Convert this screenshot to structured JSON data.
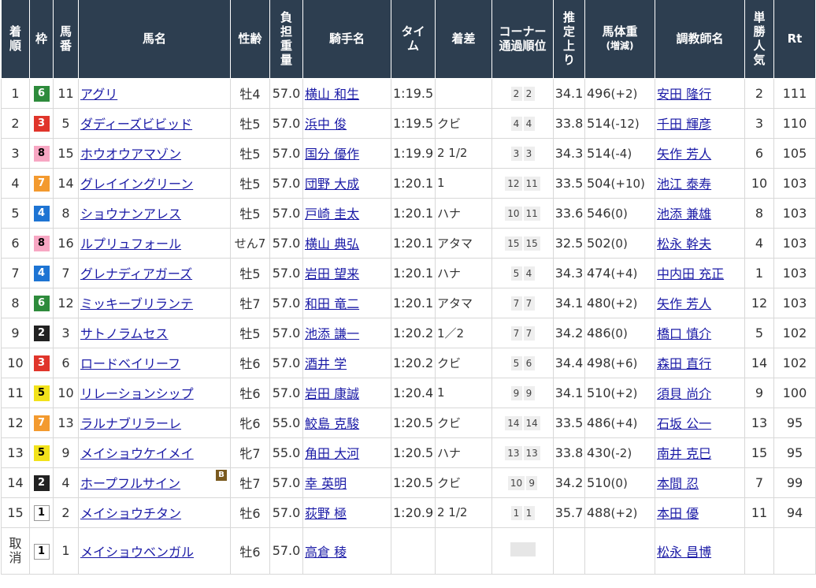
{
  "headers": {
    "finish": "着順",
    "waku": "枠",
    "umaban": "馬番",
    "horse": "馬名",
    "sexage": "性齢",
    "weight": "負担重量",
    "jockey": "騎手名",
    "time": "タイム",
    "margin": "着差",
    "corner": "コーナー通過順位",
    "last3f": "推定上り",
    "bodyweight": "馬体重",
    "bodyweight_sub": "(増減)",
    "trainer": "調教師名",
    "popularity": "単勝人気",
    "rt": "Rt"
  },
  "rows": [
    {
      "finish": "1",
      "waku": "6",
      "umaban": "11",
      "horse": "アグリ",
      "sexage": "牡4",
      "weight": "57.0",
      "jockey": "横山 和生",
      "time": "1:19.5",
      "margin": "",
      "corner": [
        "2",
        "2"
      ],
      "last3f": "34.1",
      "bodyweight": "496",
      "diff": "(+2)",
      "trainer": "安田 隆行",
      "pop": "2",
      "rt": "111"
    },
    {
      "finish": "2",
      "waku": "3",
      "umaban": "5",
      "horse": "ダディーズビビッド",
      "sexage": "牡5",
      "weight": "57.0",
      "jockey": "浜中 俊",
      "time": "1:19.5",
      "margin": "クビ",
      "corner": [
        "4",
        "4"
      ],
      "last3f": "33.8",
      "bodyweight": "514",
      "diff": "(-12)",
      "trainer": "千田 輝彦",
      "pop": "3",
      "rt": "110"
    },
    {
      "finish": "3",
      "waku": "8",
      "umaban": "15",
      "horse": "ホウオウアマゾン",
      "sexage": "牡5",
      "weight": "57.0",
      "jockey": "国分 優作",
      "time": "1:19.9",
      "margin": "2 1/2",
      "corner": [
        "3",
        "3"
      ],
      "last3f": "34.3",
      "bodyweight": "514",
      "diff": "(-4)",
      "trainer": "矢作 芳人",
      "pop": "6",
      "rt": "105"
    },
    {
      "finish": "4",
      "waku": "7",
      "umaban": "14",
      "horse": "グレイイングリーン",
      "sexage": "牡5",
      "weight": "57.0",
      "jockey": "団野 大成",
      "time": "1:20.1",
      "margin": "1",
      "corner": [
        "12",
        "11"
      ],
      "last3f": "33.5",
      "bodyweight": "504",
      "diff": "(+10)",
      "trainer": "池江 泰寿",
      "pop": "10",
      "rt": "103"
    },
    {
      "finish": "5",
      "waku": "4",
      "umaban": "8",
      "horse": "ショウナンアレス",
      "sexage": "牡5",
      "weight": "57.0",
      "jockey": "戸崎 圭太",
      "time": "1:20.1",
      "margin": "ハナ",
      "corner": [
        "10",
        "11"
      ],
      "last3f": "33.6",
      "bodyweight": "546",
      "diff": "(0)",
      "trainer": "池添 兼雄",
      "pop": "8",
      "rt": "103"
    },
    {
      "finish": "6",
      "waku": "8",
      "umaban": "16",
      "horse": "ルプリュフォール",
      "sexage": "せん7",
      "weight": "57.0",
      "jockey": "横山 典弘",
      "time": "1:20.1",
      "margin": "アタマ",
      "corner": [
        "15",
        "15"
      ],
      "last3f": "32.5",
      "bodyweight": "502",
      "diff": "(0)",
      "trainer": "松永 幹夫",
      "pop": "4",
      "rt": "103"
    },
    {
      "finish": "7",
      "waku": "4",
      "umaban": "7",
      "horse": "グレナディアガーズ",
      "sexage": "牡5",
      "weight": "57.0",
      "jockey": "岩田 望来",
      "time": "1:20.1",
      "margin": "ハナ",
      "corner": [
        "5",
        "4"
      ],
      "last3f": "34.3",
      "bodyweight": "474",
      "diff": "(+4)",
      "trainer": "中内田 充正",
      "pop": "1",
      "rt": "103"
    },
    {
      "finish": "8",
      "waku": "6",
      "umaban": "12",
      "horse": "ミッキーブリランテ",
      "sexage": "牡7",
      "weight": "57.0",
      "jockey": "和田 竜二",
      "time": "1:20.1",
      "margin": "アタマ",
      "corner": [
        "7",
        "7"
      ],
      "last3f": "34.1",
      "bodyweight": "480",
      "diff": "(+2)",
      "trainer": "矢作 芳人",
      "pop": "12",
      "rt": "103"
    },
    {
      "finish": "9",
      "waku": "2",
      "umaban": "3",
      "horse": "サトノラムセス",
      "sexage": "牡5",
      "weight": "57.0",
      "jockey": "池添 謙一",
      "time": "1:20.2",
      "margin": "1／2",
      "corner": [
        "7",
        "7"
      ],
      "last3f": "34.2",
      "bodyweight": "486",
      "diff": "(0)",
      "trainer": "橋口 慎介",
      "pop": "5",
      "rt": "102"
    },
    {
      "finish": "10",
      "waku": "3",
      "umaban": "6",
      "horse": "ロードベイリーフ",
      "sexage": "牡6",
      "weight": "57.0",
      "jockey": "酒井 学",
      "time": "1:20.2",
      "margin": "クビ",
      "corner": [
        "5",
        "6"
      ],
      "last3f": "34.4",
      "bodyweight": "498",
      "diff": "(+6)",
      "trainer": "森田 直行",
      "pop": "14",
      "rt": "102"
    },
    {
      "finish": "11",
      "waku": "5",
      "umaban": "10",
      "horse": "リレーションシップ",
      "sexage": "牡6",
      "weight": "57.0",
      "jockey": "岩田 康誠",
      "time": "1:20.4",
      "margin": "1",
      "corner": [
        "9",
        "9"
      ],
      "last3f": "34.1",
      "bodyweight": "510",
      "diff": "(+2)",
      "trainer": "須貝 尚介",
      "pop": "9",
      "rt": "100"
    },
    {
      "finish": "12",
      "waku": "7",
      "umaban": "13",
      "horse": "ラルナブリラーレ",
      "sexage": "牝6",
      "weight": "55.0",
      "jockey": "鮫島 克駿",
      "time": "1:20.5",
      "margin": "クビ",
      "corner": [
        "14",
        "14"
      ],
      "last3f": "33.5",
      "bodyweight": "486",
      "diff": "(+4)",
      "trainer": "石坂 公一",
      "pop": "13",
      "rt": "95"
    },
    {
      "finish": "13",
      "waku": "5",
      "umaban": "9",
      "horse": "メイショウケイメイ",
      "sexage": "牝7",
      "weight": "55.0",
      "jockey": "角田 大河",
      "time": "1:20.5",
      "margin": "ハナ",
      "corner": [
        "13",
        "13"
      ],
      "last3f": "33.8",
      "bodyweight": "430",
      "diff": "(-2)",
      "trainer": "南井 克巳",
      "pop": "15",
      "rt": "95"
    },
    {
      "finish": "14",
      "waku": "2",
      "umaban": "4",
      "horse": "ホープフルサイン",
      "badge": "B",
      "sexage": "牡7",
      "weight": "57.0",
      "jockey": "幸 英明",
      "time": "1:20.5",
      "margin": "クビ",
      "corner": [
        "10",
        "9"
      ],
      "last3f": "34.2",
      "bodyweight": "510",
      "diff": "(0)",
      "trainer": "本間 忍",
      "pop": "7",
      "rt": "99"
    },
    {
      "finish": "15",
      "waku": "1",
      "umaban": "2",
      "horse": "メイショウチタン",
      "sexage": "牡6",
      "weight": "57.0",
      "jockey": "荻野 極",
      "time": "1:20.9",
      "margin": "2 1/2",
      "corner": [
        "1",
        "1"
      ],
      "last3f": "35.7",
      "bodyweight": "488",
      "diff": "(+2)",
      "trainer": "本田 優",
      "pop": "11",
      "rt": "94"
    },
    {
      "finish": "取消",
      "waku": "1",
      "umaban": "1",
      "horse": "メイショウベンガル",
      "sexage": "牡6",
      "weight": "57.0",
      "jockey": "高倉 稜",
      "time": "",
      "margin": "",
      "corner": [
        "",
        ""
      ],
      "last3f": "",
      "bodyweight": "",
      "diff": "",
      "trainer": "松永 昌博",
      "pop": "",
      "rt": ""
    }
  ]
}
